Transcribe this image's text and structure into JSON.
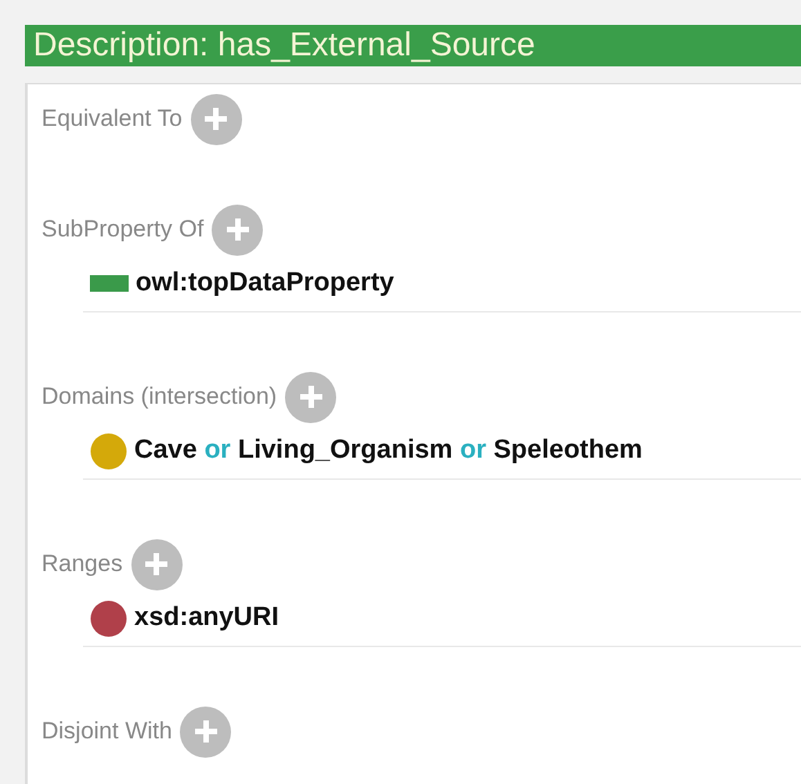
{
  "header": {
    "title": "Description: has_External_Source"
  },
  "sections": [
    {
      "label": "Equivalent To"
    },
    {
      "label": "SubProperty Of",
      "items": [
        {
          "kind": "data-property",
          "color": "#3a9a4a",
          "parts": [
            {
              "text": "owl:topDataProperty",
              "kind": "entity"
            }
          ]
        }
      ]
    },
    {
      "label": "Domains (intersection)",
      "items": [
        {
          "kind": "class",
          "color": "#d4a90a",
          "parts": [
            {
              "text": "Cave",
              "kind": "entity"
            },
            {
              "text": "or",
              "kind": "keyword"
            },
            {
              "text": "Living_Organism",
              "kind": "entity"
            },
            {
              "text": "or",
              "kind": "keyword"
            },
            {
              "text": "Speleothem",
              "kind": "entity"
            }
          ]
        }
      ]
    },
    {
      "label": "Ranges",
      "items": [
        {
          "kind": "datatype",
          "color": "#b0404a",
          "parts": [
            {
              "text": "xsd:anyURI",
              "kind": "entity"
            }
          ]
        }
      ]
    },
    {
      "label": "Disjoint With"
    }
  ]
}
